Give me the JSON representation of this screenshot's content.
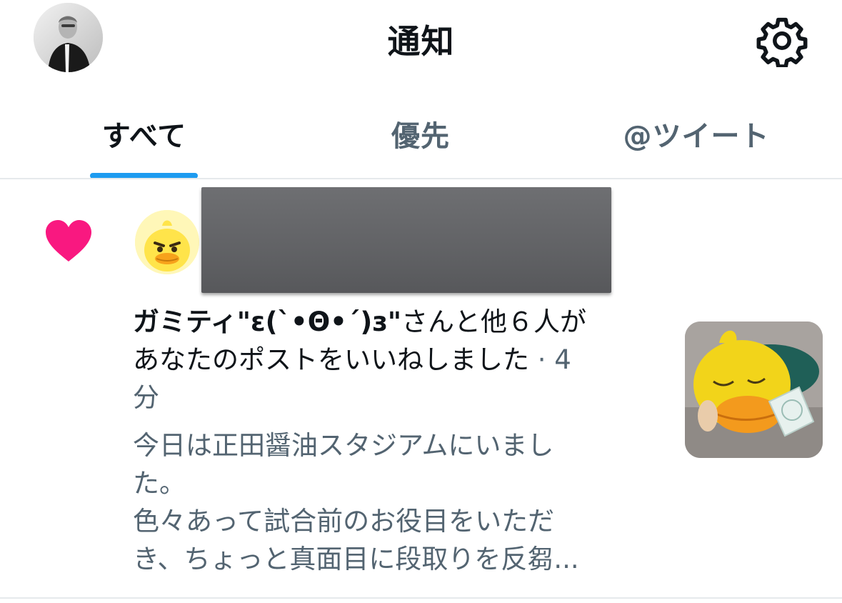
{
  "header": {
    "title": "通知",
    "profile_avatar_icon": "user-photo-icon",
    "settings_icon": "gear-icon"
  },
  "tabs": [
    {
      "label": "すべて",
      "active": true
    },
    {
      "label": "優先",
      "active": false
    },
    {
      "label": "@ツイート",
      "active": false
    }
  ],
  "colors": {
    "accent": "#1d9bf0",
    "like": "#f91880",
    "text_primary": "#0f1419",
    "text_secondary": "#536471"
  },
  "notification": {
    "type_icon": "heart-icon",
    "actor_name": "ガミティ\"ε(`•Θ•´)з\"",
    "action_text_1": "さんと他６人が",
    "action_text_2": "あなたのポストをいいねしました",
    "time_separator": " · ",
    "time_number": "4",
    "time_unit": "分",
    "snippet_lines": [
      "今日は正田醤油スタジアムにいまし",
      "た。",
      "色々あって試合前のお役目をいただ",
      "き、ちょっと真面目に段取りを反芻..."
    ],
    "thumbnail_icon": "plush-duck-photo-icon"
  }
}
